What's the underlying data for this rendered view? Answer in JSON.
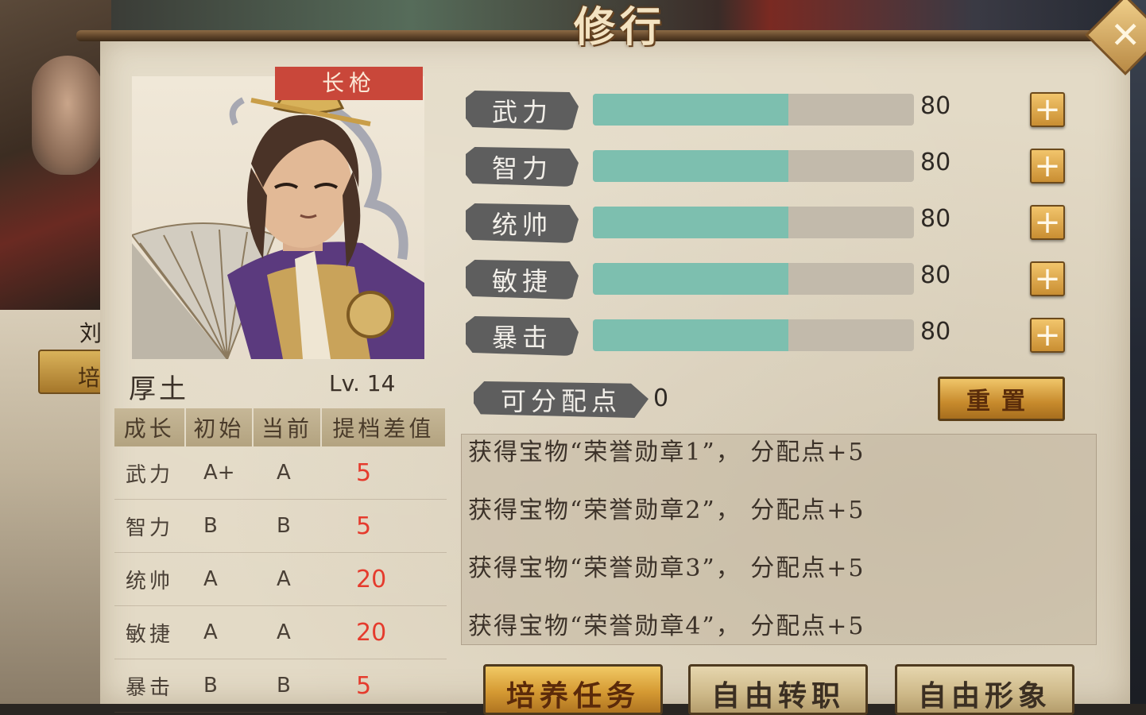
{
  "title": "修行",
  "close_icon": "close-icon",
  "background": {
    "left_name_char": "刘",
    "left_button_label": "培"
  },
  "hero": {
    "weapon": "长枪",
    "name": "厚土",
    "level": "Lv. 14"
  },
  "growth_table": {
    "headers": [
      "成长",
      "初始",
      "当前",
      "提档差值"
    ],
    "rows": [
      {
        "stat": "武力",
        "initial": "A+",
        "current": "A",
        "diff": "5"
      },
      {
        "stat": "智力",
        "initial": "B",
        "current": "B",
        "diff": "5"
      },
      {
        "stat": "统帅",
        "initial": "A",
        "current": "A",
        "diff": "20"
      },
      {
        "stat": "敏捷",
        "initial": "A",
        "current": "A",
        "diff": "20"
      },
      {
        "stat": "暴击",
        "initial": "B",
        "current": "B",
        "diff": "5"
      }
    ]
  },
  "stats": [
    {
      "label": "武力",
      "value": "80",
      "fill": 0.61
    },
    {
      "label": "智力",
      "value": "80",
      "fill": 0.61
    },
    {
      "label": "统帅",
      "value": "80",
      "fill": 0.61
    },
    {
      "label": "敏捷",
      "value": "80",
      "fill": 0.61
    },
    {
      "label": "暴击",
      "value": "80",
      "fill": 0.61
    }
  ],
  "plus_label": "+",
  "points": {
    "label": "可分配点",
    "value": "0"
  },
  "reset_label": "重置",
  "log": [
    "获得宝物“荣誉勋章1”， 分配点+5",
    "获得宝物“荣誉勋章2”， 分配点+5",
    "获得宝物“荣誉勋章3”， 分配点+5",
    "获得宝物“荣誉勋章4”， 分配点+5"
  ],
  "buttons": {
    "training": "培养任务",
    "transfer": "自由转职",
    "appearance": "自由形象"
  },
  "colors": {
    "bar_fill": "#7dbfaf",
    "diff_red": "#e53b2d",
    "weapon_tag": "#c9473a"
  }
}
